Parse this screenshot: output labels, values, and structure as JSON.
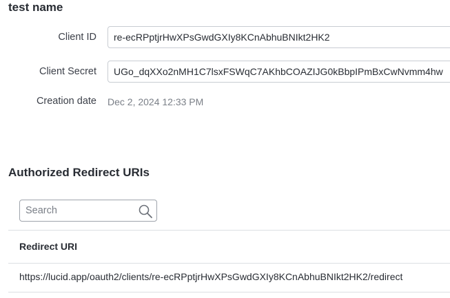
{
  "client": {
    "name": "test name",
    "client_id_label": "Client ID",
    "client_id_value": "re-ecRPptjrHwXPsGwdGXIy8KCnAbhuBNIkt2HK2",
    "client_secret_label": "Client Secret",
    "client_secret_value": "UGo_dqXXo2nMH1C7lsxFSWqC7AKhbCOAZIJG0kBbpIPmBxCwNvmm4hw",
    "creation_date_label": "Creation date",
    "creation_date_value": "Dec 2, 2024 12:33 PM"
  },
  "redirects": {
    "title": "Authorized Redirect URIs",
    "search": {
      "placeholder": "Search",
      "value": "",
      "icon": "search-icon"
    },
    "columns": [
      "Redirect URI"
    ],
    "rows": [
      [
        "https://lucid.app/oauth2/clients/re-ecRPptjrHwXPsGwdGXIy8KCnAbhuBNIkt2HK2/redirect"
      ]
    ]
  },
  "colors": {
    "text": "#282c33",
    "muted": "#7a7f87",
    "border": "#c8ccd2",
    "divider": "#dcdfe3"
  }
}
